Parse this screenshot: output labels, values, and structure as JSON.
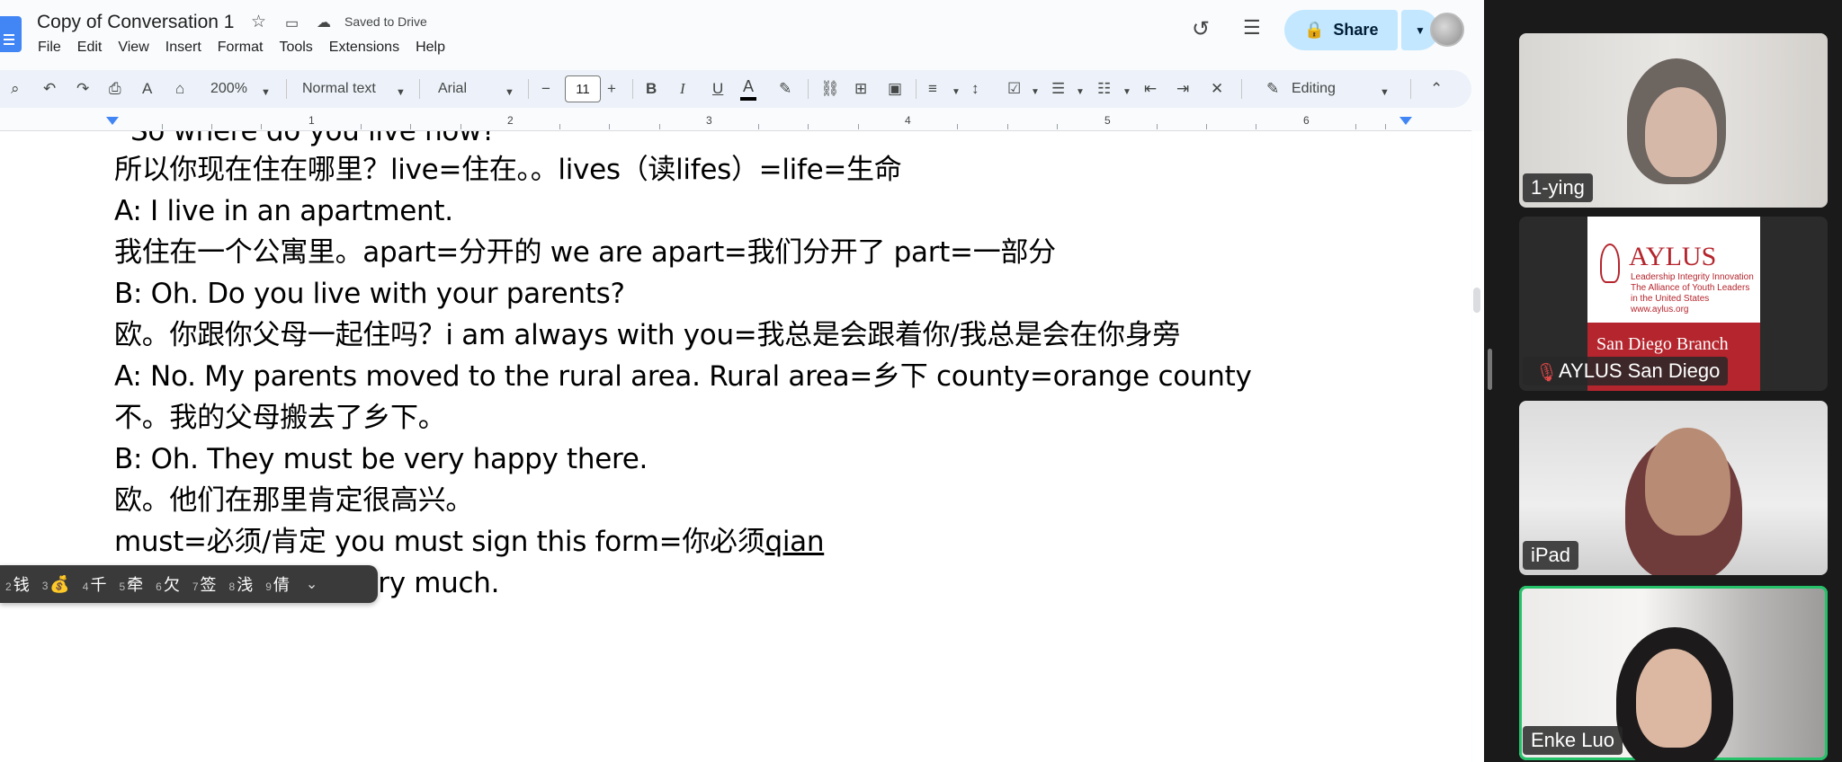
{
  "docs": {
    "title": "Copy of Conversation 1",
    "saved_status": "Saved to Drive",
    "menu": [
      "File",
      "Edit",
      "View",
      "Insert",
      "Format",
      "Tools",
      "Extensions",
      "Help"
    ],
    "share_label": "Share",
    "toolbar": {
      "zoom": "200%",
      "style": "Normal text",
      "font": "Arial",
      "font_size": "11",
      "mode": "Editing"
    },
    "ruler_numbers": [
      "1",
      "2",
      "3",
      "4",
      "5",
      "6"
    ],
    "lines": [
      "So where do you live now?",
      "所以你现在住在哪里？live=住在。。lives（读lifes）=life=生命",
      "A: I live in an apartment.",
      "我住在一个公寓里。apart=分开的 we are apart=我们分开了 part=一部分",
      "B: Oh. Do you live with your parents?",
      "欧。你跟你父母一起住吗？i am always with you=我总是会跟着你/我总是会在你身旁",
      "A: No. My parents moved to the rural area. Rural area=乡下 county=orange county",
      "不。我的父母搬去了乡下。",
      "B: Oh. They must be very happy there.",
      "欧。他们在那里肯定很高兴。",
      "must=必须/肯定 you must sign this form=你必须",
      "qian",
      "ed it very much."
    ],
    "ime_candidates": [
      {
        "n": "2",
        "c": "钱"
      },
      {
        "n": "3",
        "c": "💰"
      },
      {
        "n": "4",
        "c": "千"
      },
      {
        "n": "5",
        "c": "牵"
      },
      {
        "n": "6",
        "c": "欠"
      },
      {
        "n": "7",
        "c": "签"
      },
      {
        "n": "8",
        "c": "浅"
      },
      {
        "n": "9",
        "c": "倩"
      }
    ]
  },
  "zoom": {
    "participants": [
      {
        "name": "1-ying"
      },
      {
        "name": "AYLUS San Diego",
        "muted": true,
        "card_title": "AYLUS",
        "card_sub": "Leadership Integrity Innovation The Alliance of Youth Leaders in the United States www.aylus.org",
        "card_band": "San Diego Branch"
      },
      {
        "name": "iPad"
      },
      {
        "name": "Enke Luo",
        "active_speaker": true
      }
    ]
  },
  "colors": {
    "share_bg": "#c2e7ff",
    "active_speaker": "#25c26a",
    "aylus_red": "#b5252d"
  }
}
